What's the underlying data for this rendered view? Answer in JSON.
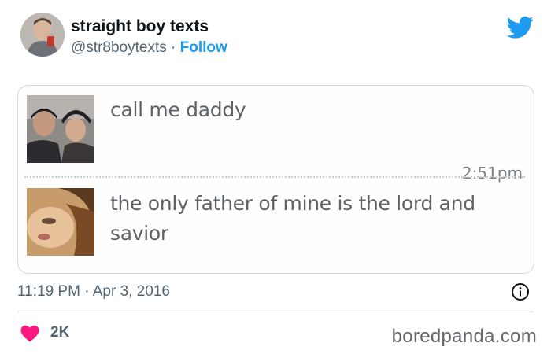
{
  "tweet": {
    "display_name": "straight boy texts",
    "handle": "@str8boytexts",
    "separator": "·",
    "follow_label": "Follow",
    "timestamp": "11:19 PM · Apr 3, 2016",
    "like_count": "2K"
  },
  "media": {
    "messages": [
      {
        "text": "call me daddy"
      },
      {
        "time": "2:51pm",
        "text": "the only father of mine is the lord and savior"
      }
    ]
  },
  "colors": {
    "accent": "#1d9bf0",
    "like": "#f91880",
    "secondary_text": "#536471"
  },
  "icons": {
    "brand": "twitter-bird-icon",
    "info": "info-icon",
    "like": "heart-icon"
  },
  "watermark": "boredpanda.com"
}
